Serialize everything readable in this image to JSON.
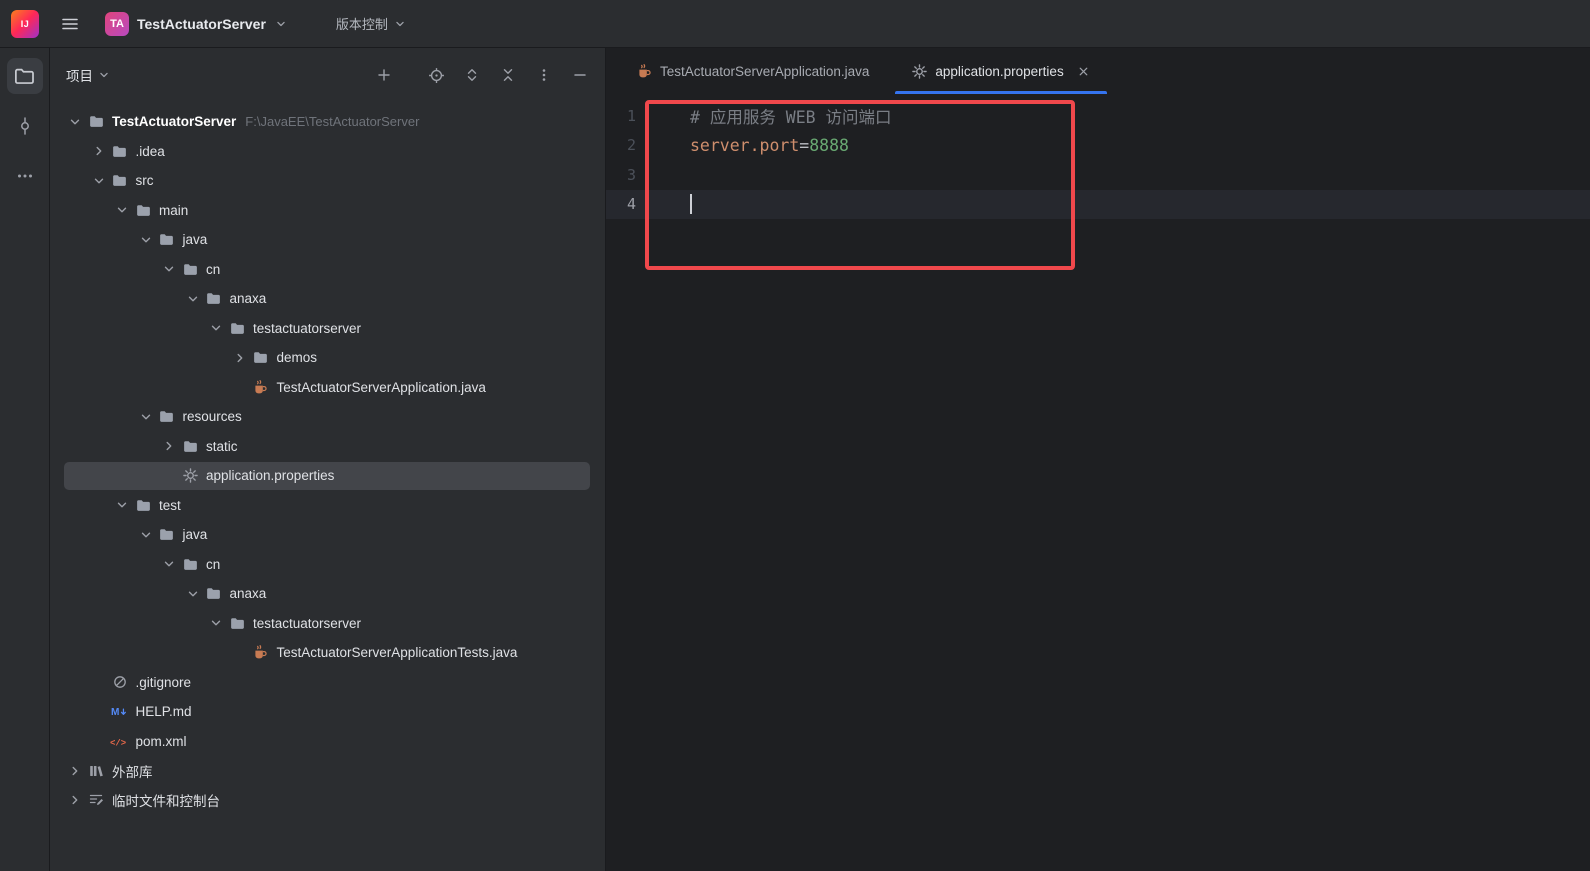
{
  "palette": {
    "accent": "#3574F0",
    "annotation": "#F0484C",
    "selection": "#43454A"
  },
  "topbar": {
    "logo_text": "IJ",
    "project_badge": "TA",
    "project_name": "TestActuatorServer",
    "vcs_label": "版本控制"
  },
  "left_rail": {
    "items": [
      {
        "id": "project",
        "icon": "project-folder",
        "active": true
      },
      {
        "id": "commit",
        "icon": "commit",
        "active": false
      },
      {
        "id": "more",
        "icon": "more-horizontal",
        "active": false
      }
    ]
  },
  "project_panel": {
    "title": "项目",
    "toolbar": [
      {
        "id": "add",
        "icon": "plus"
      },
      {
        "id": "locate",
        "icon": "locate-target"
      },
      {
        "id": "expand-all",
        "icon": "expand-all"
      },
      {
        "id": "collapse-all",
        "icon": "collapse-all"
      },
      {
        "id": "options",
        "icon": "more-vertical"
      },
      {
        "id": "hide",
        "icon": "hide-minus"
      }
    ],
    "tree": [
      {
        "label": "TestActuatorServer",
        "extra": "F:\\JavaEE\\TestActuatorServer",
        "depth": 0,
        "icon": "folder",
        "chevron": "expanded",
        "bold": true
      },
      {
        "label": ".idea",
        "depth": 1,
        "icon": "folder",
        "chevron": "collapsed"
      },
      {
        "label": "src",
        "depth": 1,
        "icon": "folder",
        "chevron": "expanded"
      },
      {
        "label": "main",
        "depth": 2,
        "icon": "folder",
        "chevron": "expanded"
      },
      {
        "label": "java",
        "depth": 3,
        "icon": "folder",
        "chevron": "expanded"
      },
      {
        "label": "cn",
        "depth": 4,
        "icon": "folder",
        "chevron": "expanded"
      },
      {
        "label": "anaxa",
        "depth": 5,
        "icon": "folder",
        "chevron": "expanded"
      },
      {
        "label": "testactuatorserver",
        "depth": 6,
        "icon": "folder",
        "chevron": "expanded"
      },
      {
        "label": "demos",
        "depth": 7,
        "icon": "folder",
        "chevron": "collapsed"
      },
      {
        "label": "TestActuatorServerApplication.java",
        "depth": 7,
        "icon": "java-class",
        "chevron": "none"
      },
      {
        "label": "resources",
        "depth": 3,
        "icon": "folder",
        "chevron": "expanded"
      },
      {
        "label": "static",
        "depth": 4,
        "icon": "folder",
        "chevron": "collapsed"
      },
      {
        "label": "application.properties",
        "depth": 4,
        "icon": "gear",
        "chevron": "none",
        "selected": true
      },
      {
        "label": "test",
        "depth": 2,
        "icon": "folder",
        "chevron": "expanded"
      },
      {
        "label": "java",
        "depth": 3,
        "icon": "folder",
        "chevron": "expanded"
      },
      {
        "label": "cn",
        "depth": 4,
        "icon": "folder",
        "chevron": "expanded"
      },
      {
        "label": "anaxa",
        "depth": 5,
        "icon": "folder",
        "chevron": "expanded"
      },
      {
        "label": "testactuatorserver",
        "depth": 6,
        "icon": "folder",
        "chevron": "expanded"
      },
      {
        "label": "TestActuatorServerApplicationTests.java",
        "depth": 7,
        "icon": "java-class",
        "chevron": "none"
      },
      {
        "label": ".gitignore",
        "depth": 1,
        "icon": "gitignore",
        "chevron": "none"
      },
      {
        "label": "HELP.md",
        "depth": 1,
        "icon": "markdown",
        "chevron": "none"
      },
      {
        "label": "pom.xml",
        "depth": 1,
        "icon": "xml",
        "chevron": "none"
      },
      {
        "label": "外部库",
        "depth": 0,
        "icon": "library",
        "chevron": "collapsed"
      },
      {
        "label": "临时文件和控制台",
        "depth": 0,
        "icon": "scratches",
        "chevron": "collapsed"
      }
    ]
  },
  "editor": {
    "tabs": [
      {
        "label": "TestActuatorServerApplication.java",
        "icon": "java-class",
        "active": false,
        "closable": false
      },
      {
        "label": "application.properties",
        "icon": "gear",
        "active": true,
        "closable": true
      }
    ],
    "lines": [
      {
        "n": "1",
        "segments": [
          {
            "text": "# 应用服务 WEB 访问端口",
            "color": "#7A7E85"
          }
        ]
      },
      {
        "n": "2",
        "segments": [
          {
            "text": "server.port",
            "color": "#CF8E6D"
          },
          {
            "text": "=",
            "color": "#BCBEC4"
          },
          {
            "text": "8888",
            "color": "#6AAB73"
          }
        ]
      },
      {
        "n": "3",
        "segments": []
      },
      {
        "n": "4",
        "segments": [],
        "current": true,
        "caret": true
      }
    ]
  },
  "annotation": {
    "type": "rectangle",
    "color": "#F0484C"
  }
}
